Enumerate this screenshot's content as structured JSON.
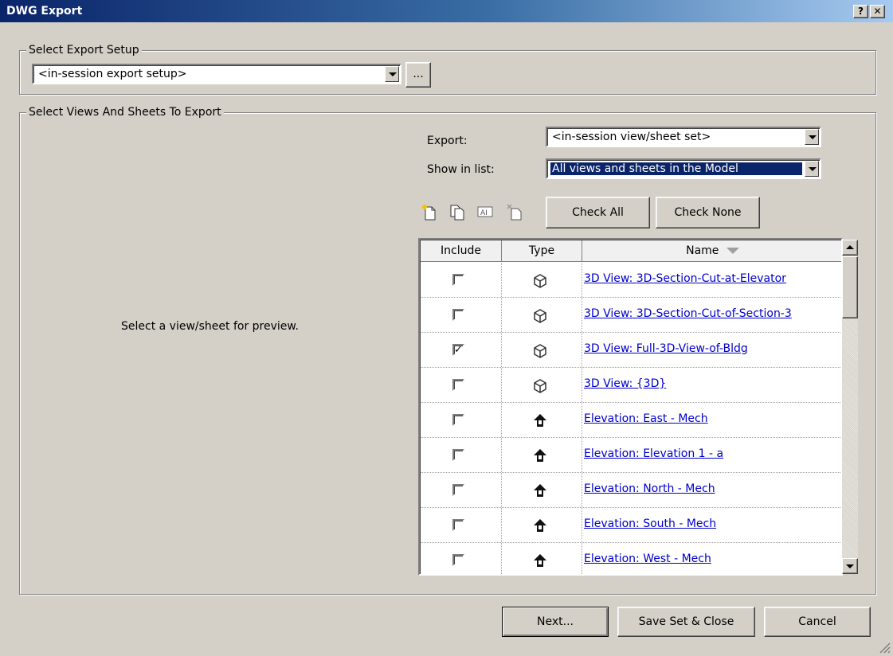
{
  "window": {
    "title": "DWG Export",
    "help_label": "?",
    "close_label": "✕"
  },
  "setup": {
    "group_label": "Select Export Setup",
    "selected": "<in-session export setup>",
    "more_label": "..."
  },
  "views": {
    "group_label": "Select Views And Sheets To Export",
    "preview_text": "Select a view/sheet for preview.",
    "export_label": "Export:",
    "export_value": "<in-session view/sheet set>",
    "show_label": "Show in list:",
    "show_value": "All views and sheets in the Model",
    "tools": [
      "new-set-icon",
      "duplicate-set-icon",
      "rename-set-icon",
      "delete-set-icon"
    ],
    "check_all_label": "Check All",
    "check_none_label": "Check None"
  },
  "grid": {
    "headers": [
      "Include",
      "Type",
      "Name"
    ],
    "rows": [
      {
        "checked": false,
        "type": "3d-view-icon",
        "name": "3D View: 3D-Section-Cut-at-Elevator"
      },
      {
        "checked": false,
        "type": "3d-view-icon",
        "name": "3D View: 3D-Section-Cut-of-Section-3"
      },
      {
        "checked": true,
        "type": "3d-view-icon",
        "name": "3D View: Full-3D-View-of-Bldg"
      },
      {
        "checked": false,
        "type": "3d-view-icon",
        "name": "3D View: {3D}"
      },
      {
        "checked": false,
        "type": "elevation-icon",
        "name": "Elevation: East - Mech"
      },
      {
        "checked": false,
        "type": "elevation-icon",
        "name": "Elevation: Elevation 1 - a"
      },
      {
        "checked": false,
        "type": "elevation-icon",
        "name": "Elevation: North - Mech"
      },
      {
        "checked": false,
        "type": "elevation-icon",
        "name": "Elevation: South - Mech"
      },
      {
        "checked": false,
        "type": "elevation-icon",
        "name": "Elevation: West - Mech"
      }
    ]
  },
  "footer": {
    "next_label": "Next...",
    "save_label": "Save Set & Close",
    "cancel_label": "Cancel"
  }
}
